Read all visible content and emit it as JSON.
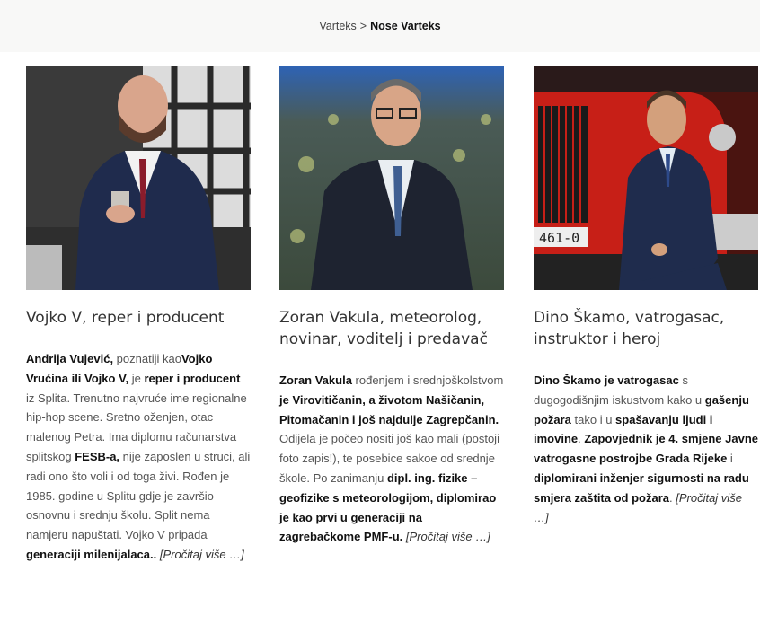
{
  "breadcrumb": {
    "parent": "Varteks",
    "separator": ">",
    "current": "Nose Varteks"
  },
  "cards": [
    {
      "title": "Vojko V, reper i producent",
      "body": [
        {
          "b": "Andrija Vujević,"
        },
        {
          "t": " poznatiji kao"
        },
        {
          "b": "Vojko Vrućina ili Vojko V,"
        },
        {
          "t": " je "
        },
        {
          "b": "reper i producent"
        },
        {
          "t": " iz Splita. Trenutno najvruće ime regionalne hip-hop scene. Sretno oženjen, otac malenog Petra. Ima diplomu računarstva splitskog "
        },
        {
          "b": "FESB-a,"
        },
        {
          "t": " nije zaposlen u struci, ali radi ono što voli i od toga živi. Rođen je 1985. godine u Splitu gdje je završio osnovnu i srednju školu. Split nema namjeru napuštati. Vojko V pripada "
        },
        {
          "b": "generaciji milenijalaca.."
        },
        {
          "t": " "
        },
        {
          "more": "[Pročitaj više …]"
        }
      ]
    },
    {
      "title": "Zoran Vakula, meteorolog, novinar, voditelj i predavač",
      "body": [
        {
          "b": "Zoran Vakula"
        },
        {
          "t": " rođenjem i srednjoškolstvom "
        },
        {
          "b": "je Virovitičanin, a životom Našičanin, Pitomačanin i još najdulje Zagrepčanin."
        },
        {
          "t": " Odijela je počeo nositi još kao mali (postoji foto zapis!), te posebice sakoe od srednje škole. Po zanimanju "
        },
        {
          "b": "dipl. ing. fizike – geofizike s meteorologijom, diplomirao je kao prvi u generaciji na zagrebačkome PMF-u."
        },
        {
          "t": " "
        },
        {
          "more": "[Pročitaj više …]"
        }
      ]
    },
    {
      "title": "Dino Škamo, vatrogasac, instruktor i heroj",
      "body": [
        {
          "b": "Dino Škamo je vatrogasac"
        },
        {
          "t": " s dugogodišnjim iskustvom kako u "
        },
        {
          "b": "gašenju požara"
        },
        {
          "t": " tako i u "
        },
        {
          "b": "spašavanju ljudi i imovine"
        },
        {
          "t": ". "
        },
        {
          "b": "Zapovjednik je 4. smjene Javne vatrogasne postrojbe Grada Rijeke"
        },
        {
          "t": " i "
        },
        {
          "b": "diplomirani inženjer sigurnosti na radu smjera zaštita od požara"
        },
        {
          "t": ". "
        },
        {
          "more": "[Pročitaj više …]"
        }
      ]
    }
  ],
  "truck_plate": "461-0"
}
